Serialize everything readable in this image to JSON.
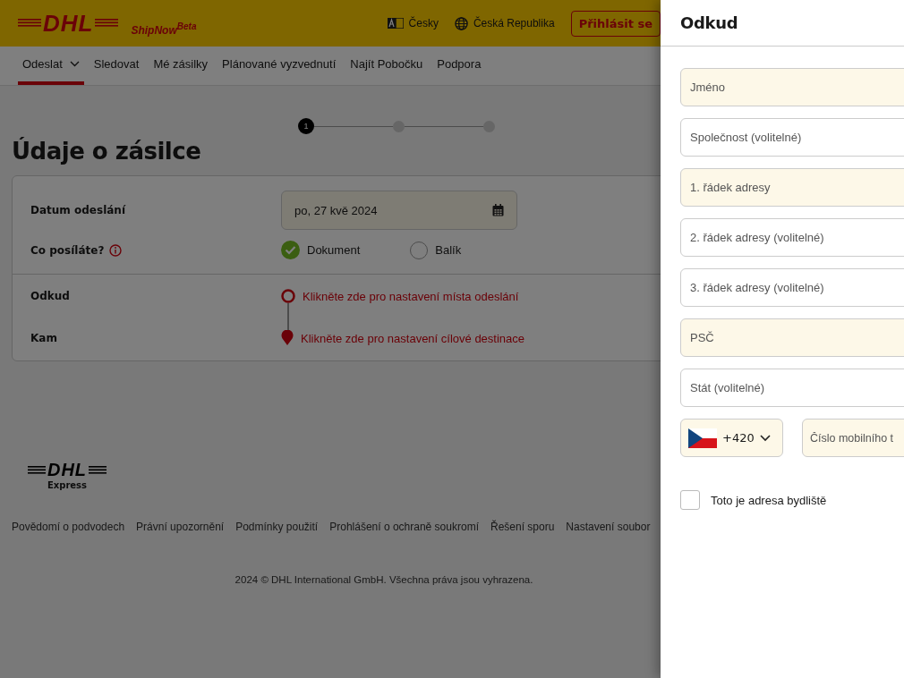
{
  "header": {
    "logo": "DHL",
    "product": "ShipNow$^{Beta}$",
    "language": "Česky",
    "country": "Česká Republika",
    "login": "Přihlásit se"
  },
  "nav": [
    {
      "label": "Odeslat",
      "selected": true,
      "dropdown": true
    },
    {
      "label": "Sledovat",
      "selected": false,
      "dropdown": false
    },
    {
      "label": "Mé zásilky",
      "selected": false,
      "dropdown": false
    },
    {
      "label": "Plánované vyzvednutí",
      "selected": false,
      "dropdown": false
    },
    {
      "label": "Najít Pobočku",
      "selected": false,
      "dropdown": false
    },
    {
      "label": "Podpora",
      "selected": false,
      "dropdown": false
    }
  ],
  "stepper": [
    {
      "number": "1",
      "current": true
    },
    {
      "current": false
    },
    {
      "current": false
    }
  ],
  "title": "Údaje o zásilce",
  "shipment": {
    "date_label": "Datum odeslání",
    "date_value": "po, 27 kvě 2024",
    "type_label": "Co posíláte?",
    "types": [
      {
        "label": "Dokument",
        "selected": true
      },
      {
        "label": "Balík",
        "selected": false
      }
    ],
    "from_label": "Odkud",
    "from_link": "Klikněte zde pro nastavení místa odeslání",
    "to_label": "Kam",
    "to_link": "Klikněte zde pro nastavení cílové destinace"
  },
  "footer": {
    "logo": "DHL",
    "logo_sub": "Express",
    "links": [
      "Povědomí o podvodech",
      "Právní upozornění",
      "Podmínky použití",
      "Prohlášení o ochraně soukromí",
      "Řešení sporu",
      "Nastavení soubor"
    ],
    "copyright": "2024 © DHL International GmbH. Všechna práva jsou vyhrazena."
  },
  "drawer": {
    "title": "Odkud",
    "fields": [
      {
        "placeholder": "Jméno",
        "required": true
      },
      {
        "placeholder": "Společnost (volitelné)",
        "required": false
      },
      {
        "placeholder": "1. řádek adresy",
        "required": true
      },
      {
        "placeholder": "2. řádek adresy (volitelné)",
        "required": false
      },
      {
        "placeholder": "3. řádek adresy (volitelné)",
        "required": false
      },
      {
        "placeholder": "PSČ",
        "required": true
      },
      {
        "placeholder": "Stát (volitelné)",
        "required": false
      }
    ],
    "phone_code": "+420",
    "phone_placeholder": "Číslo mobilního t",
    "residential": {
      "label": "Toto je adresa bydliště",
      "checked": false
    }
  }
}
